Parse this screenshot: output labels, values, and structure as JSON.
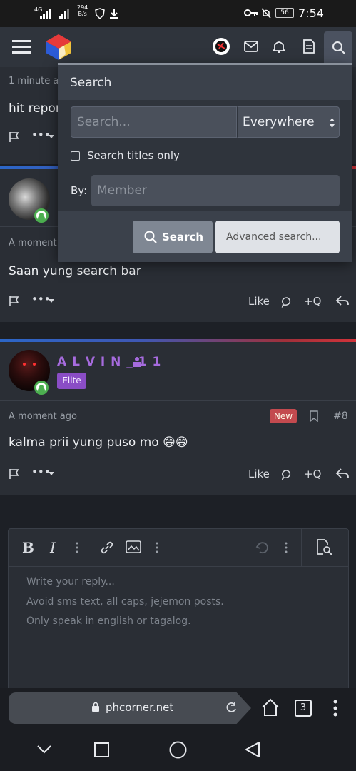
{
  "status_bar": {
    "signal_label": "4G",
    "net_speed": "294",
    "net_unit": "B/s",
    "battery": "56",
    "time": "7:54"
  },
  "forum": {
    "post1_time": "1 minute ago",
    "post1_text": "hit repor",
    "post2_time": "A moment",
    "post2_text": "Saan yung search bar",
    "post3": {
      "username": "A L V I N _ 1 1",
      "badge": "Elite",
      "time": "A moment ago",
      "new_badge": "New",
      "post_number": "#8",
      "text": "kalma prii yung puso mo 😄😄"
    },
    "action_labels": {
      "like": "Like",
      "quote": "+Q",
      "more": "•••"
    }
  },
  "editor": {
    "placeholder_lines": [
      "Write your reply...",
      "Avoid sms text, all caps, jejemon posts.",
      "Only speak in english or tagalog."
    ]
  },
  "search_dropdown": {
    "title": "Search",
    "search_placeholder": "Search...",
    "scope_selected": "Everywhere",
    "titles_only_label": "Search titles only",
    "by_label": "By:",
    "member_placeholder": "Member",
    "search_button": "Search",
    "advanced_button": "Advanced search..."
  },
  "browser": {
    "url": "phcorner.net",
    "tab_count": "3"
  },
  "colors": {
    "accent_purple": "#8a4dc6",
    "new_red": "#c34a4f",
    "online_green": "#4caf50"
  }
}
